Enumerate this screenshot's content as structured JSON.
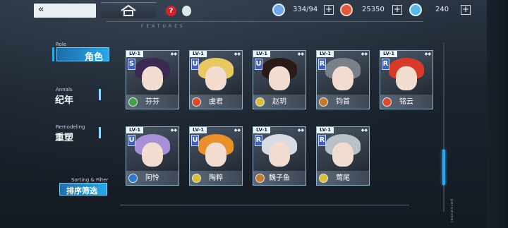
{
  "topbar": {
    "back_label": "«",
    "resources": [
      {
        "icon": "stamina-icon",
        "value": "334/94",
        "color": "#6ea8e8"
      },
      {
        "icon": "coin-icon",
        "value": "25350",
        "color": "#e05a3a"
      },
      {
        "icon": "gear-icon",
        "value": "240",
        "color": "#5ab6e6"
      }
    ],
    "help_label": "?"
  },
  "nav": {
    "role_en": "Role",
    "role_cn": "角色",
    "annals_en": "Annals",
    "annals_cn": "纪年",
    "remodel_en": "Remodeling",
    "remodel_cn": "重塑",
    "sort_en": "Sorting & Filter",
    "sort_cn": "排序筛选"
  },
  "header": {
    "features": "FEATURES"
  },
  "side_text": "personnel",
  "cards": [
    {
      "lv": "LV-1",
      "rank": "SR",
      "name": "芬芬",
      "elem_color": "#3aa64a",
      "hair": "#3a2a52"
    },
    {
      "lv": "LV-1",
      "rank": "UR",
      "name": "虞君",
      "elem_color": "#e04a2a",
      "hair": "#e8c860"
    },
    {
      "lv": "LV-1",
      "rank": "UR",
      "name": "赵玥",
      "elem_color": "#d8c030",
      "hair": "#2a1a1a"
    },
    {
      "lv": "LV-1",
      "rank": "R",
      "name": "钧首",
      "elem_color": "#c87a2a",
      "hair": "#7a8088"
    },
    {
      "lv": "LV-1",
      "rank": "R",
      "name": "铭云",
      "elem_color": "#e04a2a",
      "hair": "#d83a2a"
    },
    {
      "lv": "LV-1",
      "rank": "UR",
      "name": "阿怜",
      "elem_color": "#2a7ad8",
      "hair": "#a890d8"
    },
    {
      "lv": "LV-1",
      "rank": "UR",
      "name": "陶粹",
      "elem_color": "#d8c030",
      "hair": "#e8902a"
    },
    {
      "lv": "LV-1",
      "rank": "R",
      "name": "魏子鱼",
      "elem_color": "#c87a2a",
      "hair": "#d8dce0"
    },
    {
      "lv": "LV-1",
      "rank": "R",
      "name": "莺尾",
      "elem_color": "#d8c030",
      "hair": "#b8c0c8"
    }
  ]
}
